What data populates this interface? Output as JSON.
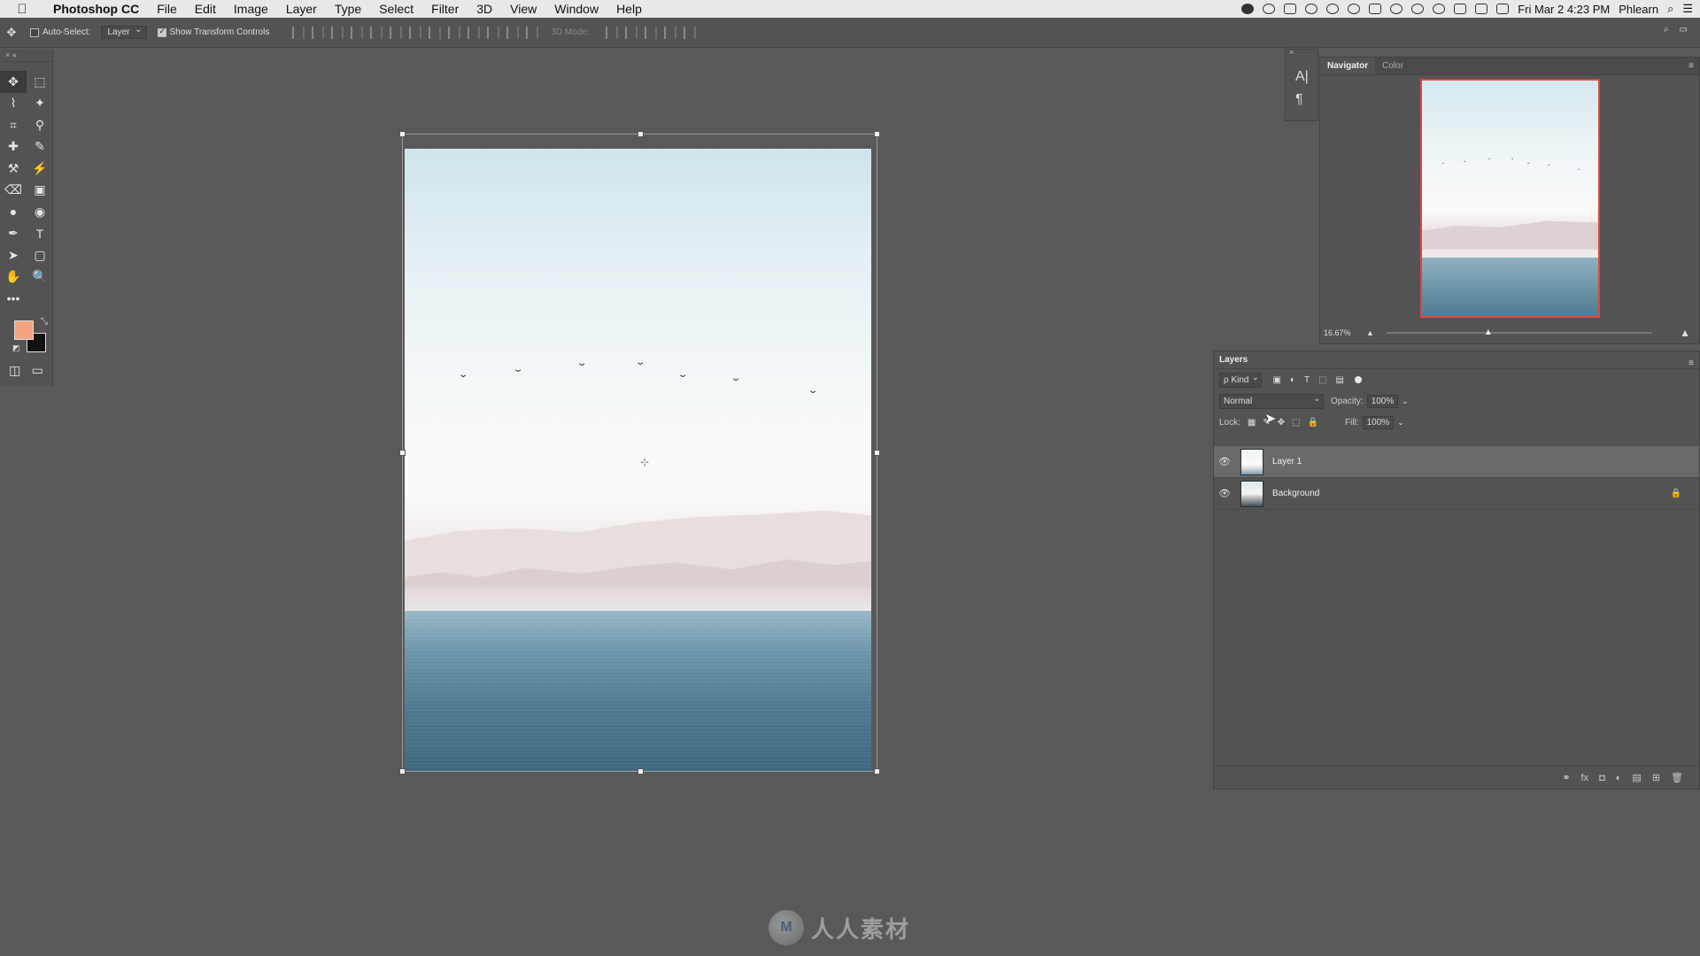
{
  "menubar": {
    "apple": "",
    "items": [
      "Photoshop CC",
      "File",
      "Edit",
      "Image",
      "Layer",
      "Type",
      "Select",
      "Filter",
      "3D",
      "View",
      "Window",
      "Help"
    ],
    "clock": "Fri Mar 2  4:23 PM",
    "user": "Phlearn",
    "search_icon": "⌕",
    "list_icon": "☰"
  },
  "optionsbar": {
    "move_icon": "✥",
    "auto_select_label": "Auto-Select:",
    "auto_select_value": "Layer",
    "transform_controls_label": "Show Transform Controls",
    "three_d_mode": "3D Mode:",
    "search_icon": "⌕",
    "workspace_icon": "▭"
  },
  "toolbar": {
    "grip": "×  «",
    "tools": [
      "✥",
      "⬚",
      "⌇",
      "✦",
      "⌗",
      "⚲",
      "✚",
      "✎",
      "⚒",
      "⚡",
      "⌫",
      "▣",
      "●",
      "◉",
      "✒",
      "T",
      "➤",
      "▢",
      "✋",
      "🔍"
    ],
    "more": "•••",
    "swap": "⤡",
    "default_colors": "◩",
    "quick_mask": "◫",
    "screen_mode": "▭",
    "foreground_color": "#f2a380",
    "background_color": "#111111"
  },
  "canvas": {
    "pivot": "⊹",
    "bird_glyph": "⌄"
  },
  "watermark_logo": {
    "badge": "M",
    "text": "人人素材"
  },
  "side_strip": {
    "close": "×",
    "character_icon": "A|",
    "paragraph_icon": "¶"
  },
  "navigator": {
    "tabs": [
      "Navigator",
      "Color"
    ],
    "menu_icon": "≡",
    "zoom": "16.67%",
    "zoom_out_icon": "▲",
    "zoom_in_icon": "▲",
    "slider_thumb": "▲",
    "bird_glyph": "⌄"
  },
  "layers": {
    "close": "×",
    "title": "Layers",
    "menu_icon": "≡",
    "filter_kind": "ρ Kind",
    "filter_icons": [
      "▣",
      "◐",
      "T",
      "⬚",
      "▤"
    ],
    "blend_mode": "Normal",
    "opacity_label": "Opacity:",
    "opacity_value": "100%",
    "lock_label": "Lock:",
    "lock_icons": [
      "▦",
      "✎",
      "✥",
      "⬚",
      "🔒"
    ],
    "fill_label": "Fill:",
    "fill_value": "100%",
    "caret": "⌄",
    "eye_icon": "👁",
    "lock_icon": "🔒",
    "items": [
      {
        "name": "Layer 1"
      },
      {
        "name": "Background"
      }
    ],
    "footer_icons": [
      "⚭",
      "fx",
      "◘",
      "◐",
      "▤",
      "⊞",
      "🗑"
    ]
  },
  "cursor": "➤"
}
